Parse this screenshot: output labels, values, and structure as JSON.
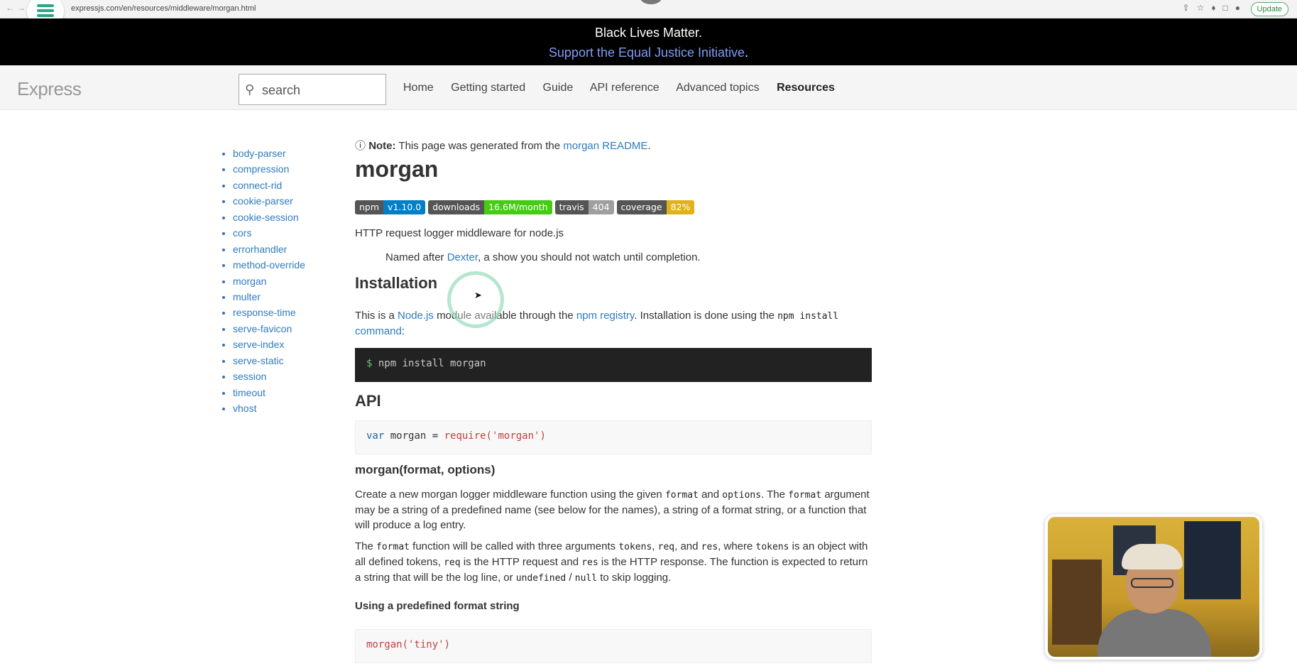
{
  "browser": {
    "url": "expressjs.com/en/resources/middleware/morgan.html",
    "update_label": "Update"
  },
  "announcement": {
    "line1": "Black Lives Matter.",
    "link": "Support the Equal Justice Initiative",
    "link_suffix": "."
  },
  "header": {
    "brand": "Express",
    "search_placeholder": "search",
    "nav": [
      "Home",
      "Getting started",
      "Guide",
      "API reference",
      "Advanced topics",
      "Resources"
    ],
    "active_nav": "Resources"
  },
  "sidebar": {
    "items": [
      "body-parser",
      "compression",
      "connect-rid",
      "cookie-parser",
      "cookie-session",
      "cors",
      "errorhandler",
      "method-override",
      "morgan",
      "multer",
      "response-time",
      "serve-favicon",
      "serve-index",
      "serve-static",
      "session",
      "timeout",
      "vhost"
    ]
  },
  "content": {
    "note_label": "Note:",
    "note_text": "This page was generated from the",
    "note_link": "morgan README",
    "note_end": ".",
    "title": "morgan",
    "badges": [
      {
        "key": "npm",
        "value": "v1.10.0",
        "color": "#007ec6"
      },
      {
        "key": "downloads",
        "value": "16.6M/month",
        "color": "#4c1"
      },
      {
        "key": "travis",
        "value": "404",
        "color": "#9f9f9f"
      },
      {
        "key": "coverage",
        "value": "82%",
        "color": "#dfb317"
      }
    ],
    "description": "HTTP request logger middleware for node.js",
    "quote_pre": "Named after",
    "quote_link": "Dexter",
    "quote_post": ", a show you should not watch until completion.",
    "installation_heading": "Installation",
    "install_p1": "This is a",
    "install_link1": "Node.js",
    "install_p2": "module available through the",
    "install_link2": "npm registry",
    "install_p3": ". Installation is done using the",
    "install_code": "npm install",
    "install_link3": "command",
    "install_p4": ":",
    "install_cmd_prompt": "$",
    "install_cmd": "npm install morgan",
    "api_heading": "API",
    "api_code_kw": "var",
    "api_code_mid": " morgan = ",
    "api_code_fn": "require",
    "api_code_str": "('morgan')",
    "fn_heading": "morgan(format, options)",
    "fn_p1_a": "Create a new morgan logger middleware function using the given",
    "fn_p1_code1": "format",
    "fn_p1_b": "and",
    "fn_p1_code2": "options",
    "fn_p1_c": ". The",
    "fn_p1_code3": "format",
    "fn_p1_d": "argument may be a string of a predefined name (see below for the names), a string of a format string, or a function that will produce a log entry.",
    "fn_p2_a": "The",
    "fn_p2_code1": "format",
    "fn_p2_b": "function will be called with three arguments",
    "fn_p2_code2": "tokens",
    "fn_p2_c": ",",
    "fn_p2_code3": "req",
    "fn_p2_d": ", and",
    "fn_p2_code4": "res",
    "fn_p2_e": ", where",
    "fn_p2_code5": "tokens",
    "fn_p2_f": "is an object with all defined tokens,",
    "fn_p2_code6": "req",
    "fn_p2_g": "is the HTTP request and",
    "fn_p2_code7": "res",
    "fn_p2_h": "is the HTTP response. The function is expected to return a string that will be the log line, or",
    "fn_p2_code8": "undefined",
    "fn_p2_i": "/",
    "fn_p2_code9": "null",
    "fn_p2_j": "to skip logging.",
    "predef_heading": "Using a predefined format string",
    "predef_code_fn": "morgan",
    "predef_code_str": "('tiny')"
  }
}
